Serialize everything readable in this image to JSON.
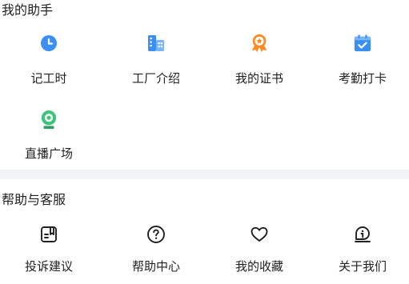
{
  "my_assistant": {
    "title": "我的助手",
    "items": [
      {
        "label": "记工时",
        "icon": "clock-icon"
      },
      {
        "label": "工厂介绍",
        "icon": "building-icon"
      },
      {
        "label": "我的证书",
        "icon": "certificate-icon"
      },
      {
        "label": "考勤打卡",
        "icon": "calendar-check-icon"
      },
      {
        "label": "直播广场",
        "icon": "webcam-icon"
      }
    ]
  },
  "help_service": {
    "title": "帮助与客服",
    "items": [
      {
        "label": "投诉建议",
        "icon": "complaint-icon"
      },
      {
        "label": "帮助中心",
        "icon": "help-icon"
      },
      {
        "label": "我的收藏",
        "icon": "heart-icon"
      },
      {
        "label": "关于我们",
        "icon": "about-icon"
      }
    ]
  },
  "colors": {
    "blue": "#3b8ff0",
    "orange": "#ff8a1f",
    "green": "#3cc47c",
    "divider": "#f2f3f5"
  }
}
